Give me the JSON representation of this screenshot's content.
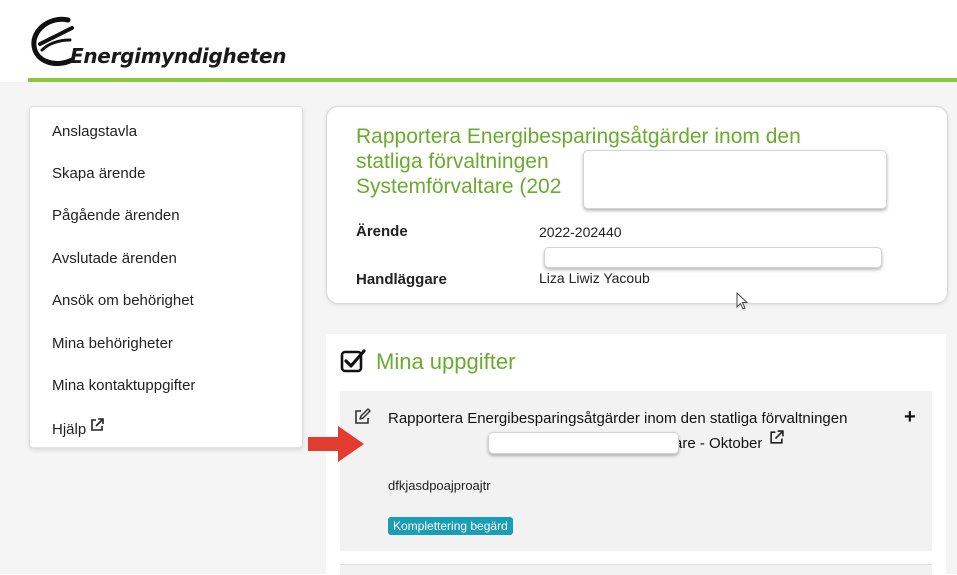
{
  "brand": {
    "name": "Energimyndigheten",
    "accent": "#8cc63f",
    "title_color": "#6aab2e"
  },
  "sidebar": {
    "items": [
      {
        "label": "Anslagstavla"
      },
      {
        "label": "Skapa ärende"
      },
      {
        "label": "Pågående ärenden"
      },
      {
        "label": "Avslutade ärenden"
      },
      {
        "label": "Ansök om behörighet"
      },
      {
        "label": "Mina behörigheter"
      },
      {
        "label": "Mina kontaktuppgifter"
      },
      {
        "label": "Hjälp",
        "icon": "external-link-icon"
      }
    ]
  },
  "case": {
    "title_line1": "Rapportera Energibesparingsåtgärder inom den",
    "title_line2": "statliga förvaltningen",
    "title_line3": "Systemförvaltare (202",
    "fields": [
      {
        "label": "Ärende",
        "value": "2022-202440"
      },
      {
        "label": "Handläggare",
        "value": "Liza Liwiz Yacoub"
      }
    ]
  },
  "tasks": {
    "heading": "Mina uppgifter",
    "heading_icon": "checked-square-icon",
    "items": [
      {
        "title_part1": "Rapportera Energibesparingsåtgärder inom den statliga förvaltningen",
        "title_part2": "- Systemförvaltare - Oktober",
        "subtitle": "dfkjasdpoajproajtr",
        "badge": "Komplettering begärd",
        "badge_color": "#1a9eb5",
        "edit_icon": "edit-icon",
        "expand_icon": "plus-icon",
        "link_icon": "external-link-icon"
      }
    ]
  }
}
